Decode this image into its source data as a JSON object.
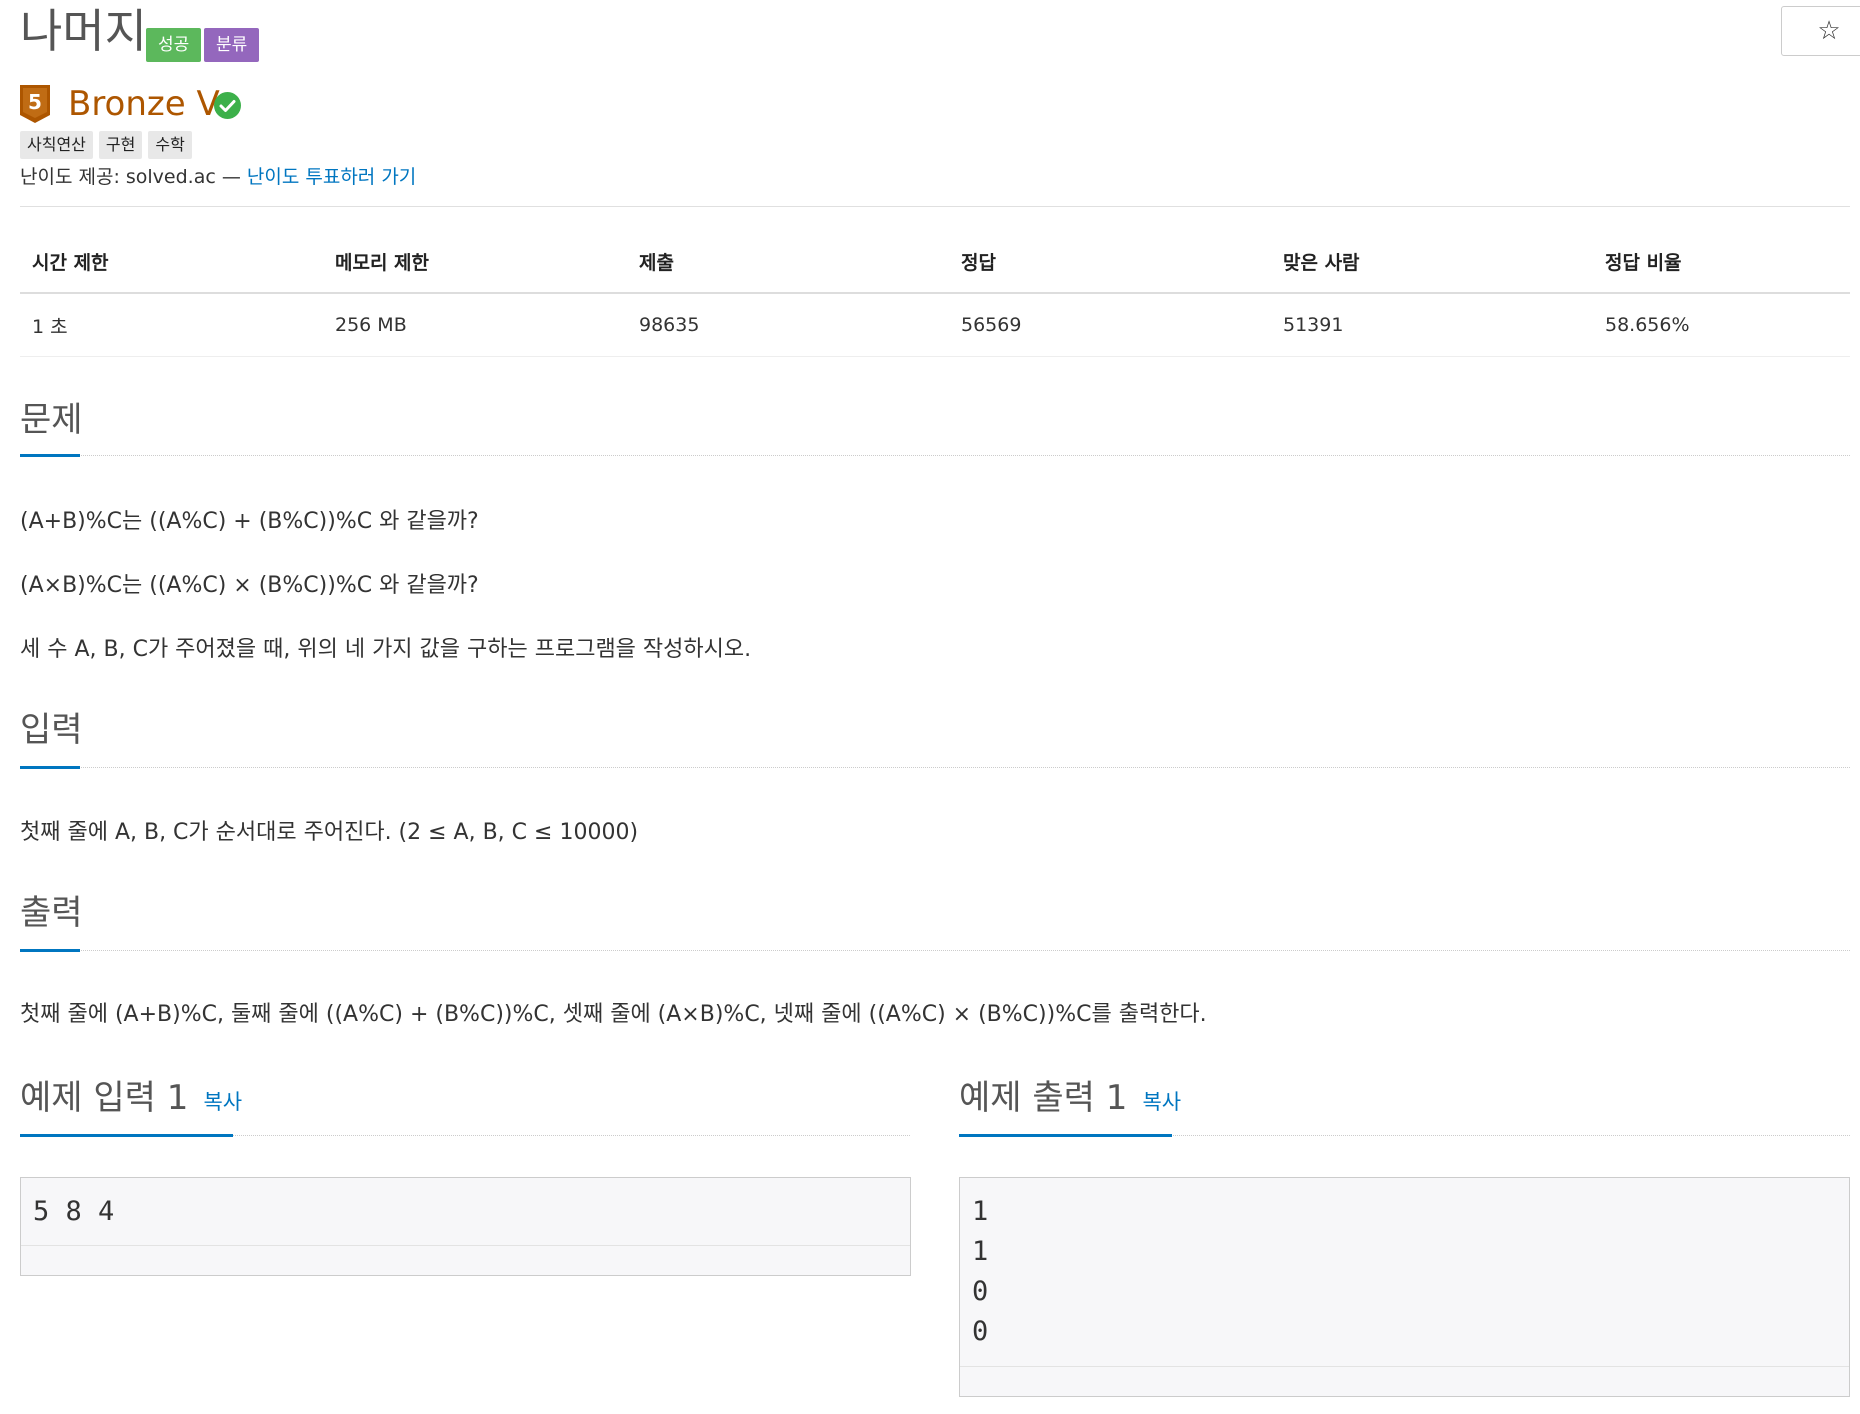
{
  "problem": {
    "title": "나머지",
    "labels": {
      "success": "성공",
      "classified": "분류"
    },
    "star_icon": "☆"
  },
  "tier": {
    "badge_number": "5",
    "name": "Bronze V",
    "color": "#ad5600",
    "solved_color": "#3cb04a"
  },
  "tags": [
    "사칙연산",
    "구현",
    "수학"
  ],
  "difficulty": {
    "provider_text": "난이도 제공: solved.ac — ",
    "vote_link": "난이도 투표하러 가기"
  },
  "info_table": {
    "headers": [
      "시간 제한",
      "메모리 제한",
      "제출",
      "정답",
      "맞은 사람",
      "정답 비율"
    ],
    "values": [
      "1 초",
      "256 MB",
      "98635",
      "56569",
      "51391",
      "58.656%"
    ]
  },
  "sections": {
    "problem": {
      "title": "문제",
      "lines": [
        "(A+B)%C는 ((A%C) + (B%C))%C 와 같을까?",
        "(A×B)%C는 ((A%C) × (B%C))%C 와 같을까?",
        "세 수 A, B, C가 주어졌을 때, 위의 네 가지 값을 구하는 프로그램을 작성하시오."
      ]
    },
    "input": {
      "title": "입력",
      "text": "첫째 줄에 A, B, C가 순서대로 주어진다. (2 ≤ A, B, C ≤ 10000)"
    },
    "output": {
      "title": "출력",
      "text": "첫째 줄에 (A+B)%C, 둘째 줄에 ((A%C) + (B%C))%C, 셋째 줄에 (A×B)%C, 넷째 줄에 ((A%C) × (B%C))%C를 출력한다."
    }
  },
  "samples": {
    "input": {
      "title": "예제 입력 1",
      "copy": "복사",
      "content": "5 8 4"
    },
    "output": {
      "title": "예제 출력 1",
      "copy": "복사",
      "content": "1\n1\n0\n0"
    }
  },
  "colors": {
    "accent": "#0076c0",
    "success": "#5cb85c",
    "classified": "#9467bd"
  }
}
